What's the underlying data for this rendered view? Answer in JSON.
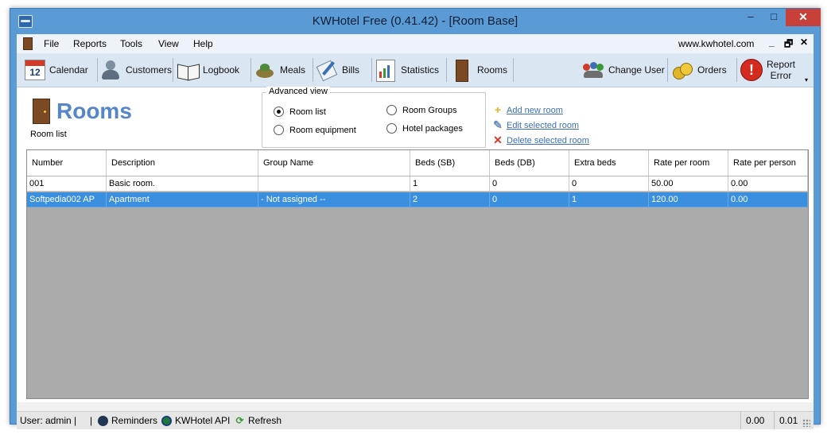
{
  "window": {
    "title": "KWHotel Free (0.41.42) - [Room Base]",
    "min": "–",
    "max": "□",
    "close": "✕"
  },
  "menu": {
    "items": [
      "File",
      "Reports",
      "Tools",
      "View",
      "Help"
    ],
    "site": "www.kwhotel.com",
    "mdi_min": "_",
    "mdi_restore": "🗗",
    "mdi_close": "✕"
  },
  "toolbar": {
    "calendar": "Calendar",
    "calendar_day": "12",
    "customers": "Customers",
    "logbook": "Logbook",
    "meals": "Meals",
    "bills": "Bills",
    "statistics": "Statistics",
    "rooms": "Rooms",
    "change_user": "Change User",
    "orders": "Orders",
    "report_error_1": "Report",
    "report_error_2": "Error"
  },
  "page": {
    "title": "Rooms",
    "subtitle": "Room list"
  },
  "advanced_view": {
    "legend": "Advanced view",
    "options": [
      "Room list",
      "Room equipment",
      "Room Groups",
      "Hotel packages"
    ],
    "selected": "Room list"
  },
  "actions": {
    "add": "Add new room",
    "edit": "Edit selected room",
    "delete": "Delete selected room"
  },
  "table": {
    "columns": [
      "Number",
      "Description",
      "Group Name",
      "Beds (SB)",
      "Beds (DB)",
      "Extra beds",
      "Rate per room",
      "Rate per person"
    ],
    "rows": [
      [
        "001",
        "Basic room.",
        "",
        "1",
        "0",
        "0",
        "50.00",
        "0.00"
      ],
      [
        "Softpedia002 AP",
        "Apartment",
        "- Not assigned --",
        "2",
        "0",
        "1",
        "120.00",
        "0.00"
      ]
    ],
    "selected_row": 1
  },
  "status": {
    "user": "User: admin |",
    "sep": "|",
    "reminders": "Reminders",
    "api": "KWHotel API",
    "refresh": "Refresh",
    "val1": "0.00",
    "val2": "0.01"
  },
  "colors": {
    "titlebar": "#5b9bd5",
    "accent": "#3a8fde",
    "heading": "#5586c9",
    "link": "#3c6fb7",
    "close": "#c7413a"
  }
}
